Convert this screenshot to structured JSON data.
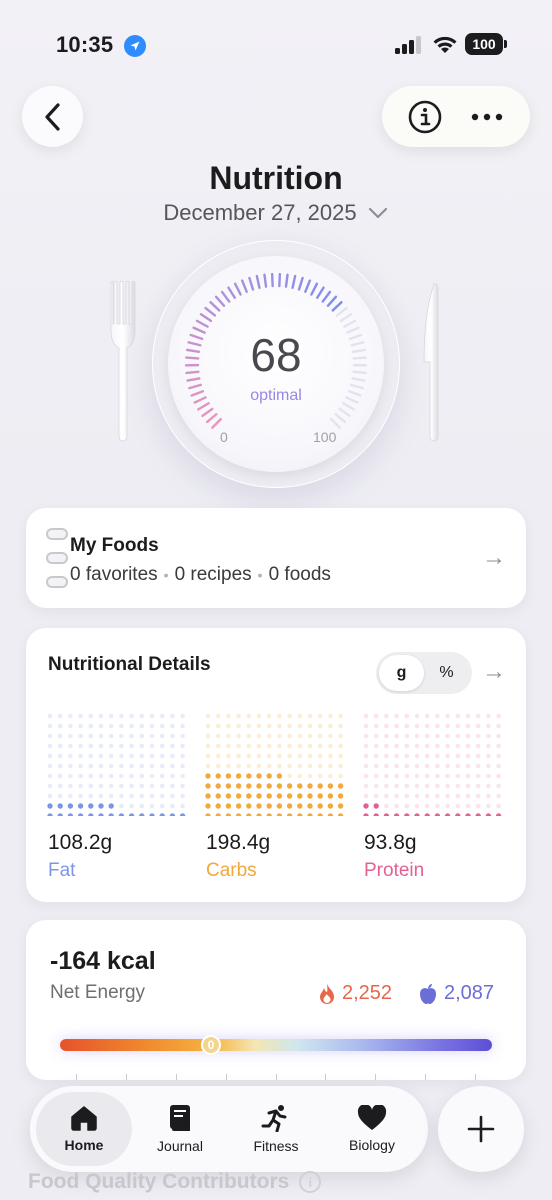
{
  "status_bar": {
    "time": "10:35",
    "battery": "100"
  },
  "header": {
    "title": "Nutrition",
    "date": "December 27, 2025"
  },
  "gauge": {
    "score": "68",
    "label": "optimal",
    "min": "0",
    "max": "100",
    "value": 68
  },
  "my_foods": {
    "title": "My Foods",
    "favorites": "0 favorites",
    "recipes": "0 recipes",
    "foods": "0 foods",
    "separator": "•"
  },
  "nutritional_details": {
    "title": "Nutritional Details",
    "unit_options": [
      "g",
      "%"
    ],
    "selected_unit": "g",
    "macros": [
      {
        "value": "108.2g",
        "name": "Fat",
        "color": "#7b96e8",
        "color_light": "#dfe5f8"
      },
      {
        "value": "198.4g",
        "name": "Carbs",
        "color": "#f2a83a",
        "color_light": "#fbe8c6"
      },
      {
        "value": "93.8g",
        "name": "Protein",
        "color": "#e36094",
        "color_light": "#f9dbe6"
      }
    ]
  },
  "net_energy": {
    "value": "-164 kcal",
    "label": "Net Energy",
    "burned": "2,252",
    "consumed": "2,087",
    "knob_label": "0",
    "burn_color": "#e8664a",
    "intake_color": "#6a6ed6"
  },
  "tab_bar": {
    "tabs": [
      {
        "label": "Home",
        "icon": "home-icon"
      },
      {
        "label": "Journal",
        "icon": "book-icon"
      },
      {
        "label": "Fitness",
        "icon": "running-icon"
      },
      {
        "label": "Biology",
        "icon": "heart-icon"
      }
    ],
    "active": "Home"
  },
  "section_below": {
    "title": "Food Quality Contributors"
  }
}
